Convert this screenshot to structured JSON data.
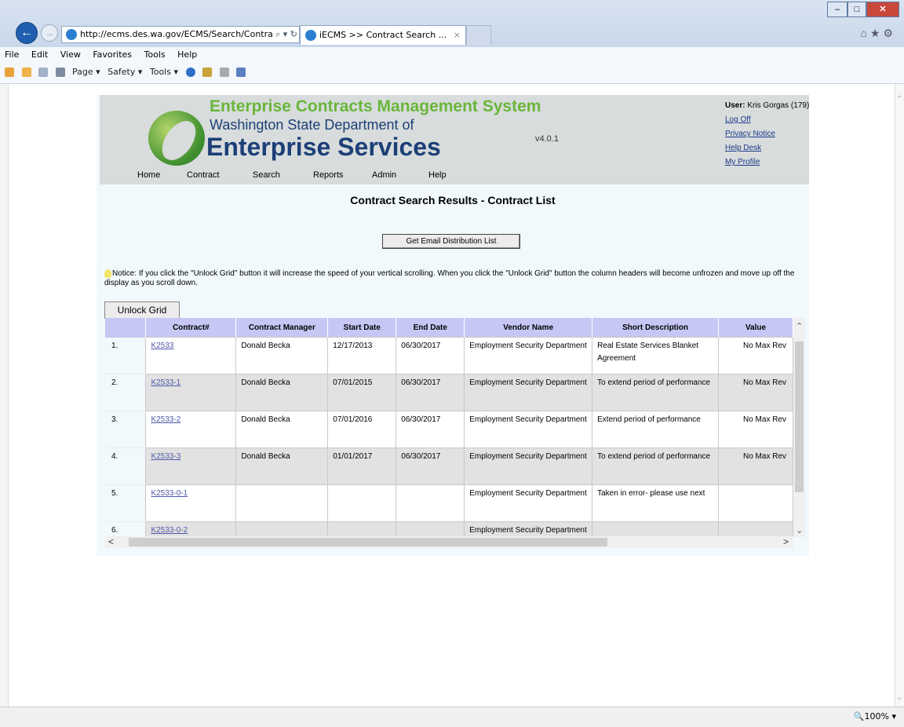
{
  "browser": {
    "url": "http://ecms.des.wa.gov/ECMS/Search/Contra",
    "url_ctrls": "⌕ ▾ ↻",
    "tab_title": "iECMS >> Contract Search ...",
    "tab_close": "×",
    "menu": [
      "File",
      "Edit",
      "View",
      "Favorites",
      "Tools",
      "Help"
    ],
    "commands": [
      "Page ▾",
      "Safety ▾",
      "Tools ▾"
    ],
    "zoom": "100%",
    "win_min": "–",
    "win_max": "□",
    "win_close": "✕",
    "right_icons": "⌂★⚙"
  },
  "header": {
    "system_title": "Enterprise Contracts Management System",
    "dept_line1": "Washington State Department of",
    "dept_line2": "Enterprise Services",
    "version": "v4.0.1",
    "user_label": "User:",
    "user_name": "Kris Gorgas (179)",
    "links": [
      "Log Off",
      "Privacy Notice",
      "Help Desk",
      "My Profile"
    ],
    "nav": [
      "Home",
      "Contract",
      "Search",
      "Reports",
      "Admin",
      "Help"
    ]
  },
  "main": {
    "heading": "Contract Search Results - Contract List",
    "email_button": "Get Email Distribution List",
    "notice": "Notice: If you click the \"Unlock Grid\" button it will increase the speed of your vertical scrolling. When you click the \"Unlock Grid\" button the column headers will become unfrozen and move up off the display as you scroll down.",
    "unlock_button": "Unlock Grid"
  },
  "grid": {
    "columns": [
      "",
      "Contract#",
      "Contract Manager",
      "Start Date",
      "End Date",
      "Vendor Name",
      "Short Description",
      "Value"
    ],
    "rows": [
      [
        "1.",
        "K2533",
        "Donald Becka",
        "12/17/2013",
        "06/30/2017",
        "Employment Security Department",
        "Real Estate Services Blanket Agreement",
        "No Max Rev"
      ],
      [
        "2.",
        "K2533-1",
        "Donald Becka",
        "07/01/2015",
        "06/30/2017",
        "Employment Security Department",
        "To extend period of performance",
        "No Max Rev"
      ],
      [
        "3.",
        "K2533-2",
        "Donald Becka",
        "07/01/2016",
        "06/30/2017",
        "Employment Security Department",
        "Extend period of performance",
        "No Max Rev"
      ],
      [
        "4.",
        "K2533-3",
        "Donald Becka",
        "01/01/2017",
        "06/30/2017",
        "Employment Security Department",
        "To extend period of performance",
        "No Max Rev"
      ],
      [
        "5.",
        "K2533-0-1",
        "",
        "",
        "",
        "Employment Security Department",
        "Taken in error- please use next",
        ""
      ],
      [
        "6.",
        "K2533-0-2",
        "",
        "",
        "",
        "Employment Security Department",
        "",
        ""
      ]
    ],
    "scroll_up": "⌃",
    "scroll_down": "⌄",
    "scroll_left": "<",
    "scroll_right": ">"
  }
}
